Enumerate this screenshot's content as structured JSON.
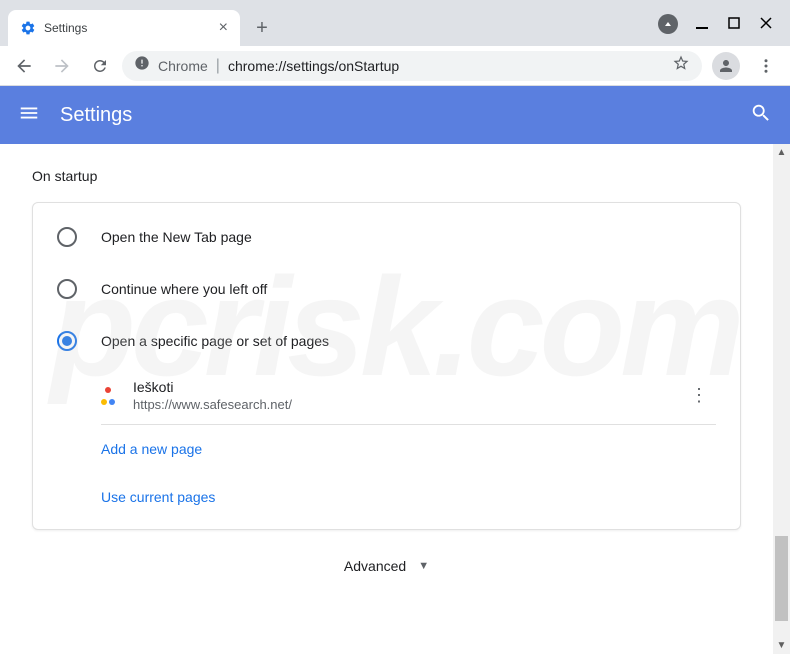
{
  "window": {
    "tab_title": "Settings"
  },
  "omnibox": {
    "chrome_label": "Chrome",
    "url": "chrome://settings/onStartup"
  },
  "header": {
    "title": "Settings"
  },
  "section": {
    "title": "On startup",
    "options": [
      {
        "label": "Open the New Tab page",
        "checked": false
      },
      {
        "label": "Continue where you left off",
        "checked": false
      },
      {
        "label": "Open a specific page or set of pages",
        "checked": true
      }
    ],
    "pages": [
      {
        "title": "Ieškoti",
        "url": "https://www.safesearch.net/"
      }
    ],
    "add_page": "Add a new page",
    "use_current": "Use current pages"
  },
  "advanced_label": "Advanced"
}
